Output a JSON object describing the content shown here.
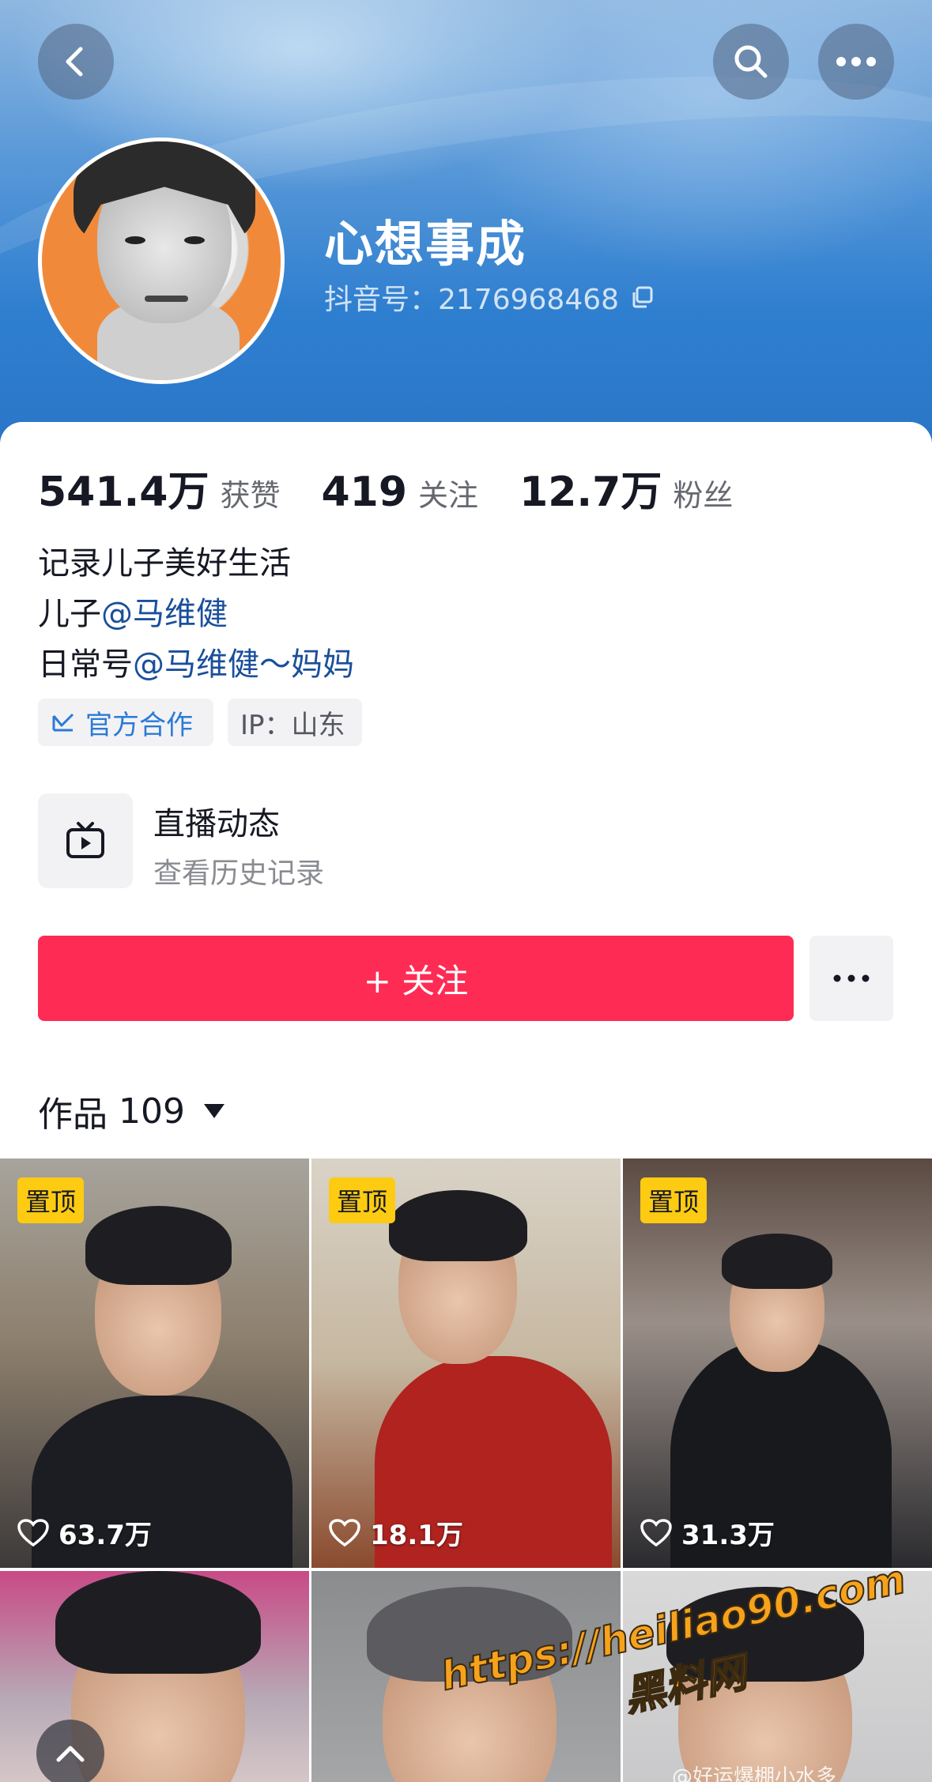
{
  "profile": {
    "nickname": "心想事成",
    "douyin_id": "抖音号：2176968468",
    "stats": [
      {
        "value": "541.4万",
        "label": "获赞"
      },
      {
        "value": "419",
        "label": "关注"
      },
      {
        "value": "12.7万",
        "label": "粉丝"
      }
    ],
    "bio": {
      "line1": "记录儿子美好生活",
      "line2_prefix": "儿子",
      "line2_mention": "@马维健",
      "line3_prefix": "日常号",
      "line3_mention": "@马维健～妈妈"
    },
    "tags": {
      "official": "官方合作",
      "ip": "IP：山东"
    },
    "live": {
      "title": "直播动态",
      "subtitle": "查看历史记录"
    },
    "follow_label": "+ 关注",
    "works": {
      "label": "作品",
      "count": "109"
    }
  },
  "videos": [
    {
      "pinned": "置顶",
      "likes": "63.7万"
    },
    {
      "pinned": "置顶",
      "likes": "18.1万"
    },
    {
      "pinned": "置顶",
      "likes": "31.3万"
    },
    {
      "pinned": "",
      "likes": ""
    },
    {
      "pinned": "",
      "likes": ""
    },
    {
      "pinned": "",
      "likes": ""
    }
  ],
  "watermark": {
    "url": "https://heiliao90.com",
    "name": "黑料网",
    "weibo": "@好运爆棚小水多"
  },
  "colors": {
    "follow_button": "#fe2c55",
    "mention": "#1a4f9c",
    "pin_badge": "#fccb12",
    "official_tag": "#2b7ad6"
  },
  "icons": [
    "back-icon",
    "search-icon",
    "more-icon",
    "copy-icon",
    "official-icon",
    "live-tv-icon",
    "heart-icon",
    "chevron-up-icon"
  ]
}
